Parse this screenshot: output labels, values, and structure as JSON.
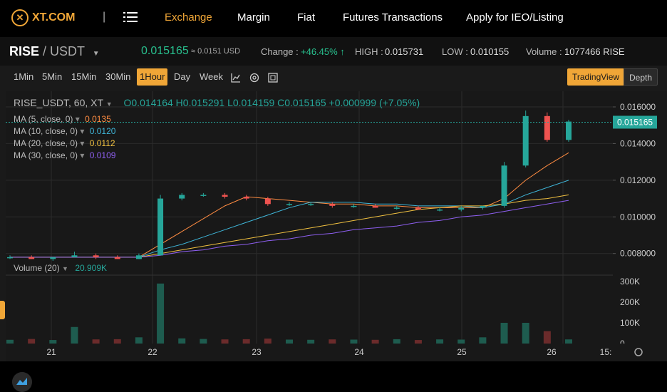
{
  "nav": {
    "logo_text": "XT.COM",
    "separator": "|",
    "items": [
      "Exchange",
      "Margin",
      "Fiat",
      "Futures Transactions",
      "Apply for IEO/Listing"
    ],
    "active": "Exchange"
  },
  "ticker": {
    "base": "RISE",
    "quote": "/ USDT",
    "price": "0.015165",
    "price_usd": "≈ 0.0151 USD",
    "change_label": "Change :",
    "change_value": "+46.45% ↑",
    "high_label": "HIGH :",
    "high_value": "0.015731",
    "low_label": "LOW :",
    "low_value": "0.010155",
    "volume_label": "Volume :",
    "volume_value": "1077466 RISE"
  },
  "toolbar": {
    "timeframes": [
      "1Min",
      "5Min",
      "15Min",
      "30Min",
      "1Hour",
      "Day",
      "Week"
    ],
    "active_timeframe": "1Hour",
    "tradingview_label": "TradingView",
    "depth_label": "Depth",
    "active_view": "TradingView"
  },
  "chart_header": {
    "symbol": "RISE_USDT, 60, XT",
    "ohlc": "O0.014164  H0.015291  L0.014159  C0.015165  +0.000999 (+7.05%)",
    "ma": [
      {
        "label": "MA (5, close, 0)",
        "value": "0.0135",
        "color": "#ff8c42"
      },
      {
        "label": "MA (10, close, 0)",
        "value": "0.0120",
        "color": "#3fb6d9"
      },
      {
        "label": "MA (20, close, 0)",
        "value": "0.0112",
        "color": "#f0c040"
      },
      {
        "label": "MA (30, close, 0)",
        "value": "0.0109",
        "color": "#8e5ff0"
      }
    ],
    "volume_label": "Volume (20)",
    "volume_value": "20.909K",
    "last_price_tag": "0.015165"
  },
  "colors": {
    "up": "#26a69a",
    "down": "#ef5350",
    "accent": "#f0a637"
  },
  "chart_data": {
    "type": "candlestick",
    "x_labels": [
      "21",
      "22",
      "23",
      "24",
      "25",
      "26",
      "15:"
    ],
    "price_ticks": [
      "0.016000",
      "0.014000",
      "0.012000",
      "0.010000",
      "0.008000"
    ],
    "volume_ticks": [
      "300K",
      "200K",
      "100K",
      "0"
    ],
    "ylim": [
      0.0069,
      0.0167
    ],
    "candles_ohlc": [
      [
        0.0078,
        0.0079,
        0.0077,
        0.0078
      ],
      [
        0.0078,
        0.0079,
        0.0077,
        0.0077
      ],
      [
        0.0077,
        0.0078,
        0.0076,
        0.0078
      ],
      [
        0.0078,
        0.0081,
        0.0078,
        0.0079
      ],
      [
        0.0079,
        0.008,
        0.0077,
        0.0078
      ],
      [
        0.0078,
        0.0079,
        0.0077,
        0.0077
      ],
      [
        0.0077,
        0.008,
        0.0077,
        0.0079
      ],
      [
        0.0079,
        0.0112,
        0.0079,
        0.011
      ],
      [
        0.011,
        0.0113,
        0.0109,
        0.0112
      ],
      [
        0.0112,
        0.0113,
        0.0111,
        0.0112
      ],
      [
        0.0112,
        0.0113,
        0.011,
        0.0111
      ],
      [
        0.0111,
        0.0112,
        0.0109,
        0.011
      ],
      [
        0.011,
        0.0111,
        0.0106,
        0.0107
      ],
      [
        0.0107,
        0.0108,
        0.0106,
        0.0107
      ],
      [
        0.0107,
        0.0108,
        0.0106,
        0.0107
      ],
      [
        0.0107,
        0.0108,
        0.0105,
        0.0106
      ],
      [
        0.0106,
        0.0107,
        0.0105,
        0.0106
      ],
      [
        0.0106,
        0.0107,
        0.0105,
        0.0105
      ],
      [
        0.0105,
        0.0106,
        0.0104,
        0.0105
      ],
      [
        0.0105,
        0.0106,
        0.0104,
        0.0104
      ],
      [
        0.0104,
        0.0105,
        0.0103,
        0.0104
      ],
      [
        0.0104,
        0.0106,
        0.0103,
        0.0105
      ],
      [
        0.0105,
        0.0106,
        0.0104,
        0.0106
      ],
      [
        0.0106,
        0.013,
        0.0105,
        0.0128
      ],
      [
        0.0128,
        0.0158,
        0.0127,
        0.0155
      ],
      [
        0.0155,
        0.0157,
        0.0141,
        0.0142
      ],
      [
        0.0142,
        0.0153,
        0.0141,
        0.0152
      ]
    ],
    "volumes_k": [
      18,
      22,
      17,
      80,
      20,
      21,
      30,
      290,
      25,
      22,
      20,
      21,
      24,
      19,
      18,
      20,
      19,
      18,
      21,
      17,
      20,
      19,
      30,
      100,
      100,
      60,
      20
    ],
    "ma_values": {
      "ma5": [
        0.0078,
        0.0078,
        0.0078,
        0.0078,
        0.0078,
        0.0078,
        0.0078,
        0.0085,
        0.0092,
        0.0099,
        0.0106,
        0.0111,
        0.011,
        0.0109,
        0.0108,
        0.0107,
        0.0107,
        0.0106,
        0.0106,
        0.0105,
        0.0105,
        0.0105,
        0.0105,
        0.011,
        0.012,
        0.0128,
        0.0135
      ],
      "ma10": [
        0.0078,
        0.0078,
        0.0078,
        0.0078,
        0.0078,
        0.0078,
        0.0078,
        0.0082,
        0.0085,
        0.0089,
        0.0093,
        0.0097,
        0.0101,
        0.0105,
        0.0108,
        0.0108,
        0.0108,
        0.0107,
        0.0107,
        0.0106,
        0.0106,
        0.0106,
        0.0105,
        0.0107,
        0.0112,
        0.0116,
        0.012
      ],
      "ma20": [
        0.0078,
        0.0078,
        0.0078,
        0.0078,
        0.0078,
        0.0078,
        0.0078,
        0.008,
        0.0082,
        0.0084,
        0.0086,
        0.0088,
        0.009,
        0.0092,
        0.0094,
        0.0096,
        0.0098,
        0.01,
        0.0102,
        0.0104,
        0.0105,
        0.0106,
        0.0106,
        0.0107,
        0.0109,
        0.011,
        0.0112
      ],
      "ma30": [
        0.0078,
        0.0078,
        0.0078,
        0.0078,
        0.0078,
        0.0078,
        0.0078,
        0.0079,
        0.0081,
        0.0082,
        0.0084,
        0.0085,
        0.0087,
        0.0088,
        0.009,
        0.0091,
        0.0093,
        0.0094,
        0.0095,
        0.0097,
        0.0098,
        0.01,
        0.0101,
        0.0103,
        0.0105,
        0.0107,
        0.0109
      ]
    }
  }
}
